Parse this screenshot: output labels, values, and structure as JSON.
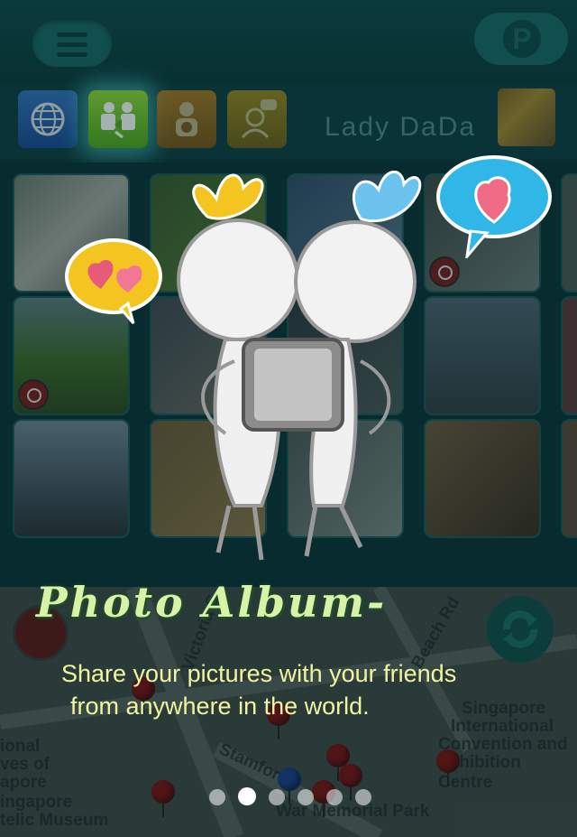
{
  "header": {
    "menu_icon": "hamburger-icon",
    "logo_icon": "p-logo-icon"
  },
  "tabs": [
    {
      "name": "globe",
      "icon": "globe-icon",
      "color": "#2d6cc8"
    },
    {
      "name": "share",
      "icon": "share-icon",
      "color": "#6cc12a",
      "active": true
    },
    {
      "name": "profile",
      "icon": "person-icon",
      "color": "#c07a14"
    },
    {
      "name": "chat",
      "icon": "chat-person-icon",
      "color": "#b08a14"
    }
  ],
  "user": {
    "name": "Lady DaDa"
  },
  "map": {
    "labels": [
      "Singapore",
      "International",
      "Convention and",
      "Exhibition Centre",
      "War Memorial Park",
      "ional",
      "ves of",
      "apore",
      "ingapore",
      "telic Museum",
      "Stamford",
      "Beach Rd",
      "Victoria S"
    ]
  },
  "onboarding": {
    "title": "Photo Album-",
    "description_line1": "Share your pictures with your friends",
    "description_line2": "from anywhere in the world.",
    "page_count": 6,
    "active_page": 2
  }
}
